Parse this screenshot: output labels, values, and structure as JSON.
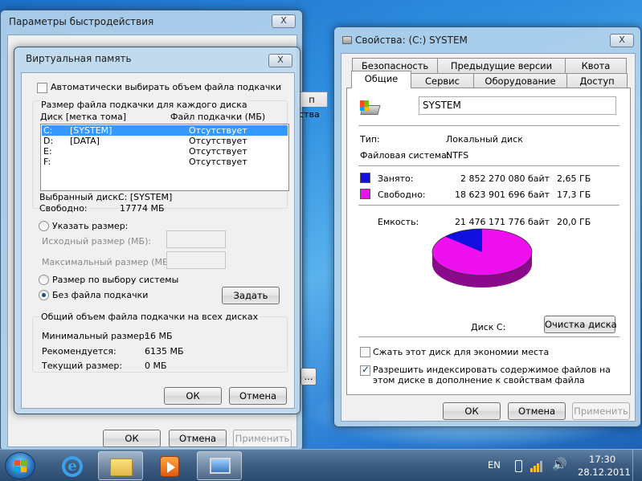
{
  "perf_window": {
    "title": "Параметры быстродействия",
    "close": "X",
    "buttons": {
      "ok": "ОК",
      "cancel": "Отмена",
      "apply": "Применить"
    },
    "partial_tab": "п",
    "partial_text": "ства",
    "partial_button": "..."
  },
  "vm_dialog": {
    "title": "Виртуальная память",
    "close": "X",
    "auto_checkbox_label": "Автоматически выбирать объем файла подкачки",
    "group_title": "Размер файла подкачки для каждого диска",
    "columns": {
      "disk": "Диск [метка тома]",
      "size": "Файл подкачки (МБ)"
    },
    "disks": [
      {
        "drive": "C:",
        "label": "[SYSTEM]",
        "size": "Отсутствует",
        "selected": true
      },
      {
        "drive": "D:",
        "label": "[DATA]",
        "size": "Отсутствует",
        "selected": false
      },
      {
        "drive": "E:",
        "label": "",
        "size": "Отсутствует",
        "selected": false
      },
      {
        "drive": "F:",
        "label": "",
        "size": "Отсутствует",
        "selected": false
      }
    ],
    "selected_disk_label": "Выбранный диск:",
    "selected_disk_value": "C:  [SYSTEM]",
    "free_label": "Свободно:",
    "free_value": "17774 МБ",
    "custom_size_label": "Указать размер:",
    "initial_size_label": "Исходный размер (МБ):",
    "max_size_label": "Максимальный размер (МБ):",
    "system_size_label": "Размер по выбору системы",
    "no_pagefile_label": "Без файла подкачки",
    "set_button": "Задать",
    "total_group_title": "Общий объем файла подкачки на всех дисках",
    "min_label": "Минимальный размер:",
    "min_value": "16 МБ",
    "recommended_label": "Рекомендуется:",
    "recommended_value": "6135 МБ",
    "current_label": "Текущий размер:",
    "current_value": "0 МБ",
    "ok": "ОК",
    "cancel": "Отмена"
  },
  "props_window": {
    "title": "Свойства: (C:) SYSTEM",
    "close": "X",
    "tabs_row1": [
      "Безопасность",
      "Предыдущие версии",
      "Квота"
    ],
    "tabs_row2": [
      "Общие",
      "Сервис",
      "Оборудование",
      "Доступ"
    ],
    "name_value": "SYSTEM",
    "type_label": "Тип:",
    "type_value": "Локальный диск",
    "fs_label": "Файловая система:",
    "fs_value": "NTFS",
    "used_label": "Занято:",
    "used_bytes": "2 852 270 080 байт",
    "used_gb": "2,65 ГБ",
    "used_color": "#1010e0",
    "free_label": "Свободно:",
    "free_bytes": "18 623 901 696 байт",
    "free_gb": "17,3 ГБ",
    "free_color": "#ee10ee",
    "capacity_label": "Емкость:",
    "capacity_bytes": "21 476 171 776 байт",
    "capacity_gb": "20,0 ГБ",
    "used_fraction": 0.1328,
    "disk_label": "Диск C:",
    "cleanup_button": "Очистка диска",
    "compress_label": "Сжать этот диск для экономии места",
    "index_label": "Разрешить индексировать содержимое файлов на этом диске в дополнение к свойствам файла",
    "ok": "ОК",
    "cancel": "Отмена",
    "apply": "Применить"
  },
  "taskbar": {
    "lang": "EN",
    "time": "17:30",
    "date": "28.12.2011",
    "items": [
      "start-orb",
      "internet-explorer",
      "windows-explorer",
      "media-player",
      "system-properties"
    ]
  }
}
